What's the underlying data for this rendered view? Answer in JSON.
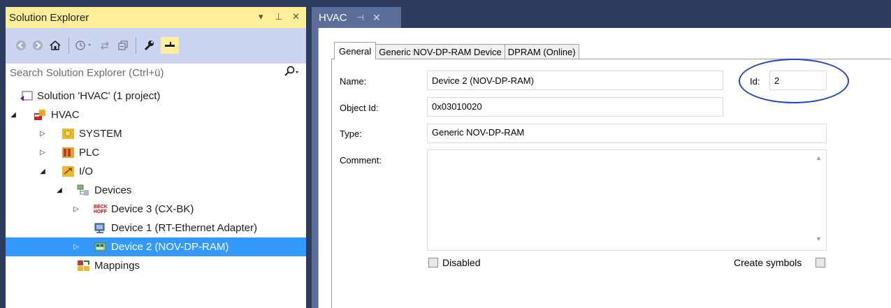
{
  "solution_explorer": {
    "title": "Solution Explorer",
    "dropdown_glyph": "▾",
    "pin_glyph": "⊥",
    "close_glyph": "✕",
    "search_placeholder": "Search Solution Explorer (Ctrl+ü)",
    "search_icon": "magnifier-icon",
    "tree": {
      "solution": "Solution 'HVAC' (1 project)",
      "project": "HVAC",
      "system": "SYSTEM",
      "plc": "PLC",
      "io": "I/O",
      "devices": "Devices",
      "device3": "Device 3 (CX-BK)",
      "device1": "Device 1 (RT-Ethernet Adapter)",
      "device2": "Device 2 (NOV-DP-RAM)",
      "mappings": "Mappings"
    },
    "beckhoff_badge_top": "BECK",
    "beckhoff_badge_bottom": "HOFF"
  },
  "editor": {
    "doc_tab": "HVAC",
    "doc_tab_pin": "⊣",
    "doc_tab_close": "✕",
    "tabs": [
      "General",
      "Generic NOV-DP-RAM Device",
      "DPRAM (Online)"
    ],
    "active_tab": "General",
    "form": {
      "name_label": "Name:",
      "name_value": "Device 2 (NOV-DP-RAM)",
      "id_label": "Id:",
      "id_value": "2",
      "objectid_label": "Object Id:",
      "objectid_value": "0x03010020",
      "type_label": "Type:",
      "type_value": "Generic NOV-DP-RAM",
      "comment_label": "Comment:",
      "comment_value": "",
      "disabled_label": "Disabled",
      "disabled_checked": false,
      "create_symbols_label": "Create symbols",
      "create_symbols_checked": false
    }
  },
  "colors": {
    "chrome": "#2d3c5c",
    "title_active": "#ffef9b",
    "toolbar": "#ccd5f0",
    "selection": "#3399ff",
    "highlight_oval": "#2442c9"
  }
}
